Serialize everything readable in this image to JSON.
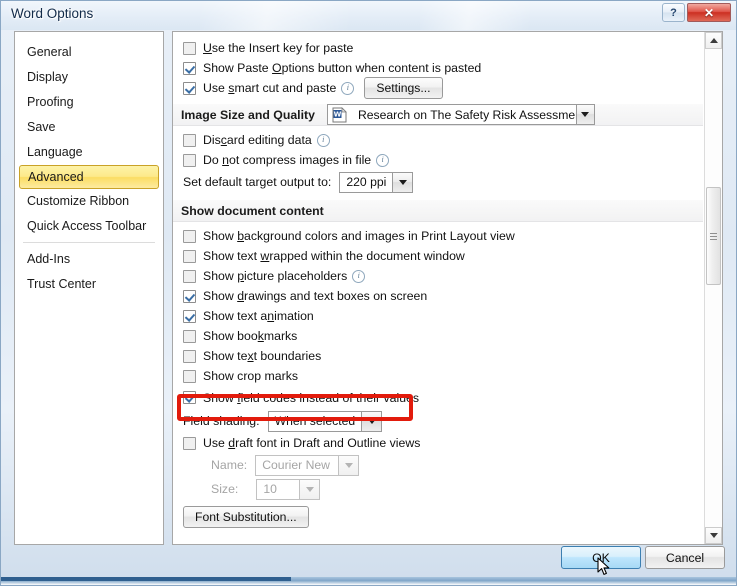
{
  "window": {
    "title": "Word Options",
    "help_label": "?",
    "close_label": "✕"
  },
  "sidebar": {
    "items": [
      {
        "label": "General",
        "selected": false
      },
      {
        "label": "Display",
        "selected": false
      },
      {
        "label": "Proofing",
        "selected": false
      },
      {
        "label": "Save",
        "selected": false
      },
      {
        "label": "Language",
        "selected": false
      },
      {
        "label": "Advanced",
        "selected": true
      },
      {
        "label": "Customize Ribbon",
        "selected": false
      },
      {
        "label": "Quick Access Toolbar",
        "selected": false
      },
      {
        "label": "Add-Ins",
        "selected": false
      },
      {
        "label": "Trust Center",
        "selected": false
      }
    ]
  },
  "content": {
    "cut_copy_paste": [
      {
        "label": "Use the Insert key for paste",
        "checked": false,
        "info": false
      },
      {
        "label": "Show Paste Options button when content is pasted",
        "checked": true,
        "info": false
      },
      {
        "label": "Use smart cut and paste",
        "checked": true,
        "info": true
      }
    ],
    "settings_button": "Settings...",
    "image_size_section": {
      "title": "Image Size and Quality",
      "document_selector": "Research on The Safety Risk Assessmen...",
      "document_icon": "word-document-icon",
      "options": [
        {
          "label": "Discard editing data",
          "checked": false,
          "info": true
        },
        {
          "label": "Do not compress images in file",
          "checked": false,
          "info": true
        }
      ],
      "target_output_label": "Set default target output to:",
      "target_output_value": "220 ppi"
    },
    "show_document_content": {
      "title": "Show document content",
      "options": [
        {
          "label": "Show background colors and images in Print Layout view",
          "checked": false,
          "info": false
        },
        {
          "label": "Show text wrapped within the document window",
          "checked": false,
          "info": false
        },
        {
          "label": "Show picture placeholders",
          "checked": false,
          "info": true
        },
        {
          "label": "Show drawings and text boxes on screen",
          "checked": true,
          "info": false
        },
        {
          "label": "Show text animation",
          "checked": true,
          "info": false
        },
        {
          "label": "Show bookmarks",
          "checked": false,
          "info": false
        },
        {
          "label": "Show text boundaries",
          "checked": false,
          "info": false
        },
        {
          "label": "Show crop marks",
          "checked": false,
          "info": false
        },
        {
          "label": "Show field codes instead of their values",
          "checked": true,
          "info": false,
          "highlighted": true
        }
      ],
      "field_shading_label": "Field shading:",
      "field_shading_value": "When selected",
      "draft_font_label": "Use draft font in Draft and Outline views",
      "draft_font_checked": false,
      "name_label": "Name:",
      "name_value": "Courier New",
      "size_label": "Size:",
      "size_value": "10",
      "font_substitution_button": "Font Substitution..."
    }
  },
  "footer": {
    "ok_label": "OK",
    "cancel_label": "Cancel"
  },
  "annotation": {
    "highlight_color": "#e21b0c",
    "target": "Show field codes instead of their values"
  }
}
